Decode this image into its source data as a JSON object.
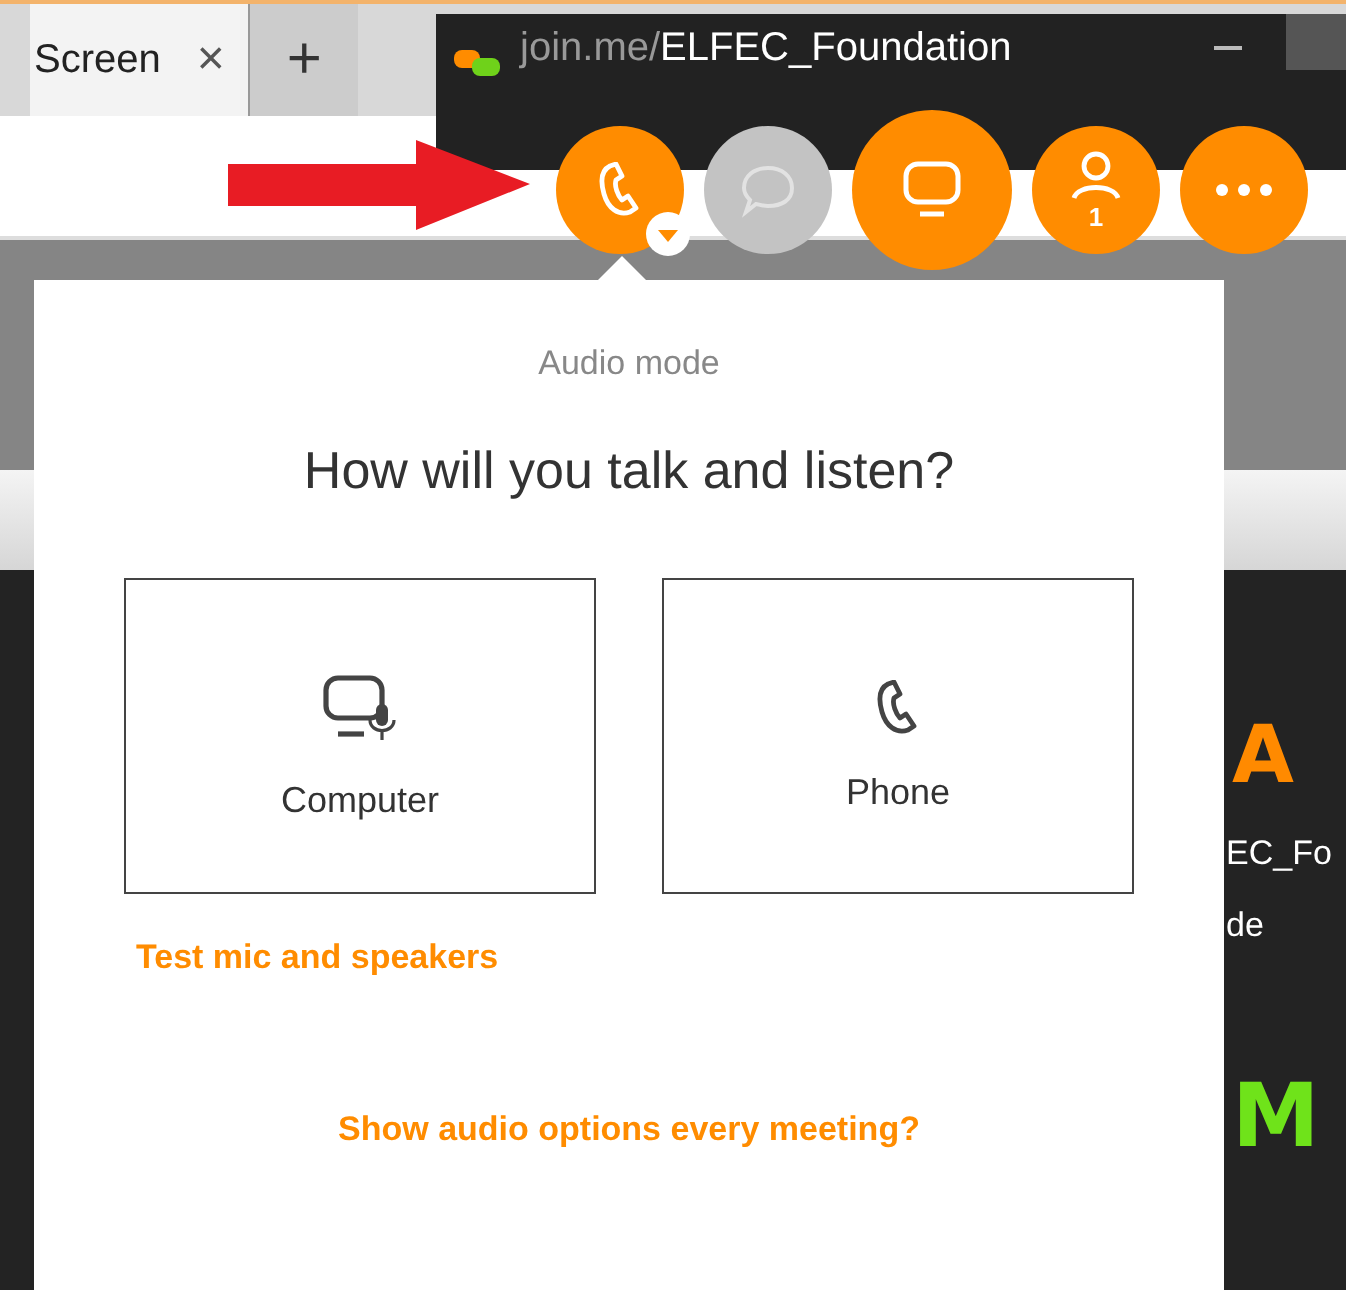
{
  "browser": {
    "tab": {
      "label": "Screen",
      "close": "×"
    },
    "new_tab": "+"
  },
  "background_content": {
    "texts": [
      {
        "text": "A",
        "kind": "orange"
      },
      {
        "text": "EC_Fo",
        "kind": "plain"
      },
      {
        "text": "de",
        "kind": "plain"
      },
      {
        "text": "M",
        "kind": "green"
      }
    ]
  },
  "meeting_window": {
    "title_prefix": "join.me/",
    "title": "ELFEC_Foundation",
    "buttons": [
      {
        "kind": "phone",
        "disabled": false,
        "menu": true
      },
      {
        "kind": "chat",
        "disabled": true,
        "menu": false
      },
      {
        "kind": "screen",
        "disabled": false,
        "menu": false
      },
      {
        "kind": "participants",
        "disabled": false,
        "menu": false,
        "count": "1"
      },
      {
        "kind": "more",
        "disabled": false,
        "menu": false
      }
    ]
  },
  "audio_popover": {
    "heading": "Audio mode",
    "question": "How will you talk and listen?",
    "options": [
      {
        "kind": "computer",
        "label": "Computer"
      },
      {
        "kind": "phone",
        "label": "Phone"
      }
    ],
    "test_link": "Test mic and speakers",
    "show_options_link": "Show audio options every meeting?"
  }
}
